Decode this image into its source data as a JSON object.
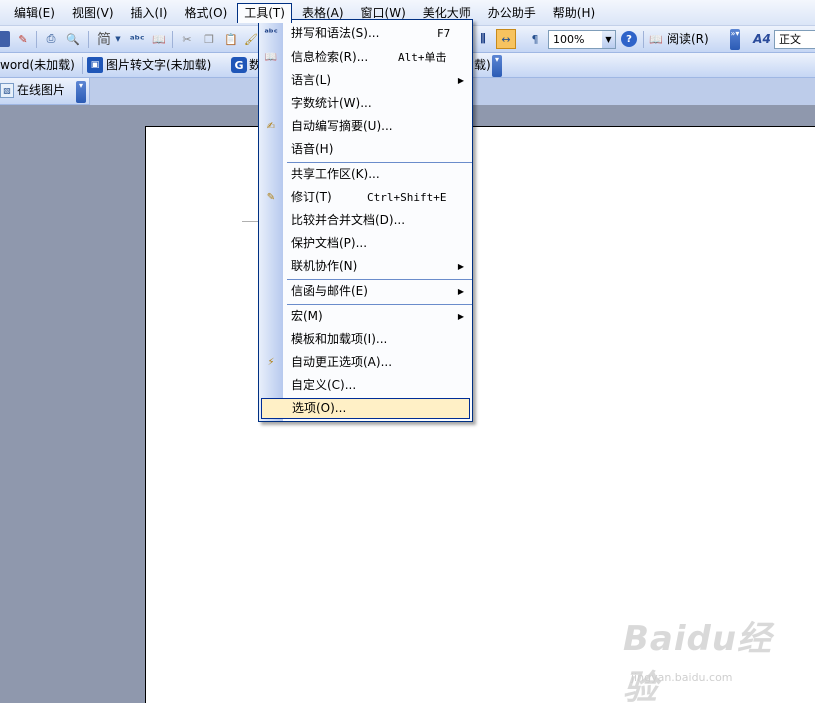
{
  "menubar": {
    "items": [
      {
        "label": "编辑(E)"
      },
      {
        "label": "视图(V)"
      },
      {
        "label": "插入(I)"
      },
      {
        "label": "格式(O)"
      },
      {
        "label": "工具(T)"
      },
      {
        "label": "表格(A)"
      },
      {
        "label": "窗口(W)"
      },
      {
        "label": "美化大师"
      },
      {
        "label": "办公助手"
      },
      {
        "label": "帮助(H)"
      }
    ]
  },
  "toolbar1": {
    "zoom": "100%",
    "read_label": "阅读(R)",
    "style_label": "正文",
    "style_icon_text": "A4"
  },
  "toolbar2": {
    "addin1": "word(未加载)",
    "addin2": "图片转文字(未加载)",
    "addin3_fragment": "数",
    "addin4_fragment": "载)"
  },
  "toolbar3": {
    "online_pictures": "在线图片"
  },
  "tools_menu": {
    "items": [
      {
        "label": "拼写和语法(S)...",
        "shortcut": "F7",
        "icon": "spelling-check-icon"
      },
      {
        "label": "信息检索(R)...",
        "shortcut": "Alt+单击",
        "icon": "research-icon"
      },
      {
        "label": "语言(L)",
        "submenu": true
      },
      {
        "label": "字数统计(W)..."
      },
      {
        "label": "自动编写摘要(U)...",
        "icon": "autosummarize-icon"
      },
      {
        "label": "语音(H)"
      },
      {
        "label": "共享工作区(K)..."
      },
      {
        "label": "修订(T)",
        "shortcut": "Ctrl+Shift+E",
        "icon": "track-changes-icon"
      },
      {
        "label": "比较并合并文档(D)..."
      },
      {
        "label": "保护文档(P)..."
      },
      {
        "label": "联机协作(N)",
        "submenu": true
      },
      {
        "label": "信函与邮件(E)",
        "submenu": true
      },
      {
        "label": "宏(M)",
        "submenu": true
      },
      {
        "label": "模板和加载项(I)..."
      },
      {
        "label": "自动更正选项(A)...",
        "icon": "autocorrect-icon"
      },
      {
        "label": "自定义(C)..."
      },
      {
        "label": "选项(O)...",
        "highlighted": true
      }
    ]
  },
  "watermark": {
    "brand": "Baidu经验",
    "url": "jingyan.baidu.com"
  }
}
